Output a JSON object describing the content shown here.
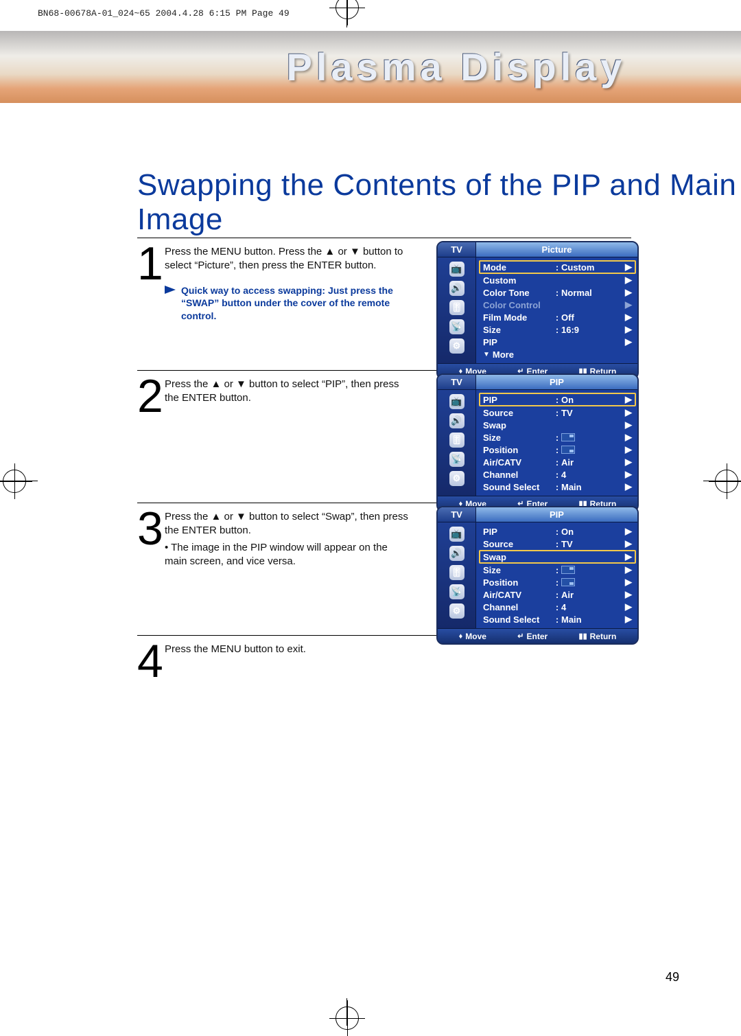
{
  "print_header": "BN68-00678A-01_024~65  2004.4.28  6:15 PM  Page 49",
  "banner_title": "Plasma Display",
  "page_title": "Swapping the Contents of the PIP and Main Image",
  "steps": {
    "1": {
      "num": "1",
      "text": "Press the MENU button. Press the ▲ or ▼ button to select “Picture”, then press the ENTER button.",
      "tip": "Quick way to access swapping: Just press the “SWAP” button under the cover of the remote control."
    },
    "2": {
      "num": "2",
      "text": "Press the ▲ or ▼ button to select “PIP”, then press the ENTER button."
    },
    "3": {
      "num": "3",
      "text": "Press the ▲ or ▼ button to select “Swap”, then press the ENTER button.",
      "bullet": "• The image in the PIP window will appear on the main screen, and vice versa."
    },
    "4": {
      "num": "4",
      "text": "Press the MENU button to exit."
    }
  },
  "osd_common": {
    "tv": "TV",
    "foot_move": "Move",
    "foot_enter": "Enter",
    "foot_return": "Return"
  },
  "osd1": {
    "title": "Picture",
    "rows": [
      {
        "label": "Mode",
        "val": "Custom",
        "sel": true
      },
      {
        "label": "Custom",
        "val": ""
      },
      {
        "label": "Color Tone",
        "val": "Normal"
      },
      {
        "label": "Color Control",
        "val": "",
        "dim": true
      },
      {
        "label": "Film Mode",
        "val": "Off"
      },
      {
        "label": "Size",
        "val": "16:9"
      },
      {
        "label": "PIP",
        "val": ""
      }
    ],
    "more": "More"
  },
  "osd2": {
    "title": "PIP",
    "rows": [
      {
        "label": "PIP",
        "val": "On",
        "sel": true
      },
      {
        "label": "Source",
        "val": "TV"
      },
      {
        "label": "Swap",
        "val": ""
      },
      {
        "label": "Size",
        "val": "[box]"
      },
      {
        "label": "Position",
        "val": "[box]"
      },
      {
        "label": "Air/CATV",
        "val": "Air"
      },
      {
        "label": "Channel",
        "val": "4"
      },
      {
        "label": "Sound Select",
        "val": "Main"
      }
    ]
  },
  "osd3": {
    "title": "PIP",
    "rows": [
      {
        "label": "PIP",
        "val": "On"
      },
      {
        "label": "Source",
        "val": "TV"
      },
      {
        "label": "Swap",
        "val": "",
        "sel": true
      },
      {
        "label": "Size",
        "val": "[box]"
      },
      {
        "label": "Position",
        "val": "[box]"
      },
      {
        "label": "Air/CATV",
        "val": "Air"
      },
      {
        "label": "Channel",
        "val": "4"
      },
      {
        "label": "Sound Select",
        "val": "Main"
      }
    ]
  },
  "page_number": "49"
}
